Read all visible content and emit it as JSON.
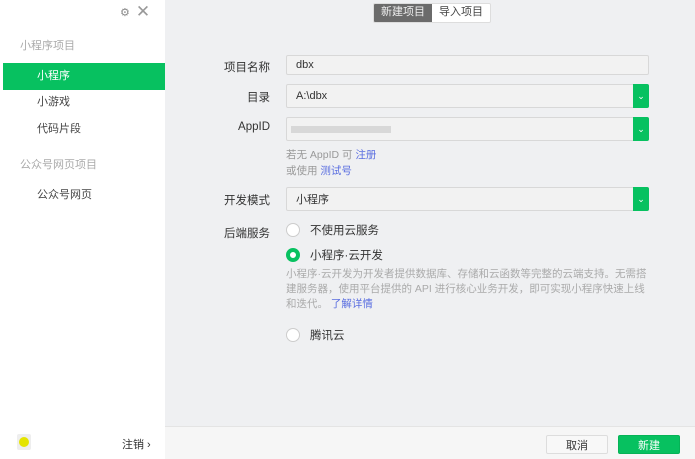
{
  "sidebar": {
    "section_miniprogram": "小程序项目",
    "items": [
      {
        "label": "小程序"
      },
      {
        "label": "小游戏"
      },
      {
        "label": "代码片段"
      }
    ],
    "section_official": "公众号网页项目",
    "official_items": [
      {
        "label": "公众号网页"
      }
    ],
    "logout": "注销 ›"
  },
  "tabs": [
    {
      "label": "新建项目"
    },
    {
      "label": "导入项目"
    }
  ],
  "form": {
    "name_label": "项目名称",
    "name_value": "dbx",
    "dir_label": "目录",
    "dir_value": "A:\\dbx",
    "appid_label": "AppID",
    "appid_hint1": "若无 AppID 可 ",
    "appid_hint1_link": "注册",
    "appid_hint2": "或使用 ",
    "appid_hint2_link": "测试号",
    "mode_label": "开发模式",
    "mode_value": "小程序",
    "backend_label": "后端服务",
    "options": [
      {
        "label": "不使用云服务"
      },
      {
        "label": "小程序·云开发"
      },
      {
        "label": "腾讯云"
      }
    ],
    "selected_option": "小程序·云开发",
    "cloud_desc": "小程序·云开发为开发者提供数据库、存储和云函数等完整的云端支持。无需搭建服务器，使用平台提供的 API 进行核心业务开发，即可实现小程序快速上线和迭代。",
    "cloud_link": "了解详情"
  },
  "footer": {
    "cancel": "取消",
    "create": "新建"
  },
  "colors": {
    "accent": "#07c160",
    "link": "#5a6ee0"
  }
}
